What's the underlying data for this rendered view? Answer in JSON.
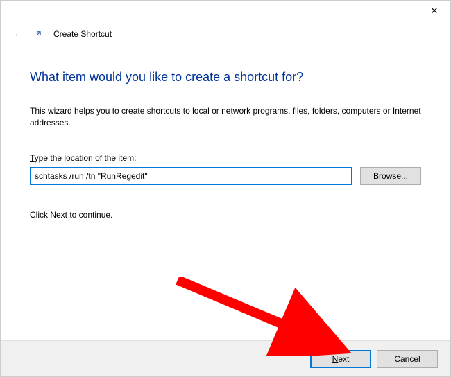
{
  "titlebar": {
    "close_glyph": "✕"
  },
  "header": {
    "back_glyph": "←",
    "icon_glyph": "🡵",
    "title": "Create Shortcut"
  },
  "main": {
    "heading": "What item would you like to create a shortcut for?",
    "description": "This wizard helps you to create shortcuts to local or network programs, files, folders, computers or Internet addresses.",
    "location_label_pre": "T",
    "location_label_rest": "ype the location of the item:",
    "location_value": "schtasks /run /tn \"RunRegedit\"",
    "browse_label": "Browse...",
    "continue_text": "Click Next to continue."
  },
  "footer": {
    "next_pre": "N",
    "next_rest": "ext",
    "cancel_label": "Cancel"
  }
}
